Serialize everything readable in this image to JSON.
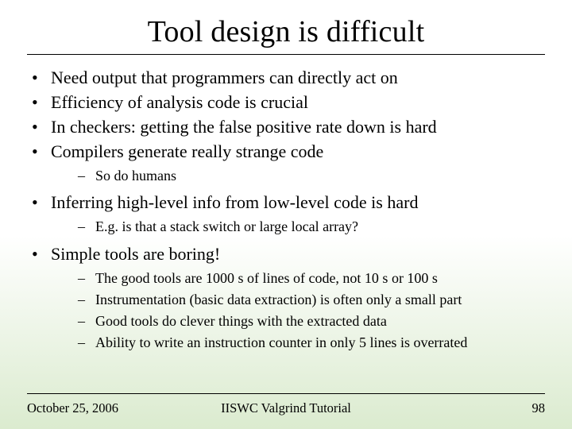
{
  "title": "Tool design is difficult",
  "bullets": {
    "b0": "Need output that programmers can directly act on",
    "b1": "Efficiency of analysis code is crucial",
    "b2": "In checkers: getting the false positive rate down is hard",
    "b3": "Compilers generate really strange code",
    "b3_sub0": "So do humans",
    "b4": "Inferring high-level info from low-level code is hard",
    "b4_sub0": "E.g. is that a stack switch or large local array?",
    "b5": "Simple tools are boring!",
    "b5_sub0": "The good tools are 1000 s of lines of code, not 10 s or 100 s",
    "b5_sub1": "Instrumentation (basic data extraction) is often only a small part",
    "b5_sub2": "Good tools do clever things with the extracted data",
    "b5_sub3": "Ability to write an instruction counter in only 5 lines is overrated"
  },
  "footer": {
    "date": "October 25, 2006",
    "venue": "IISWC Valgrind Tutorial",
    "page": "98"
  }
}
